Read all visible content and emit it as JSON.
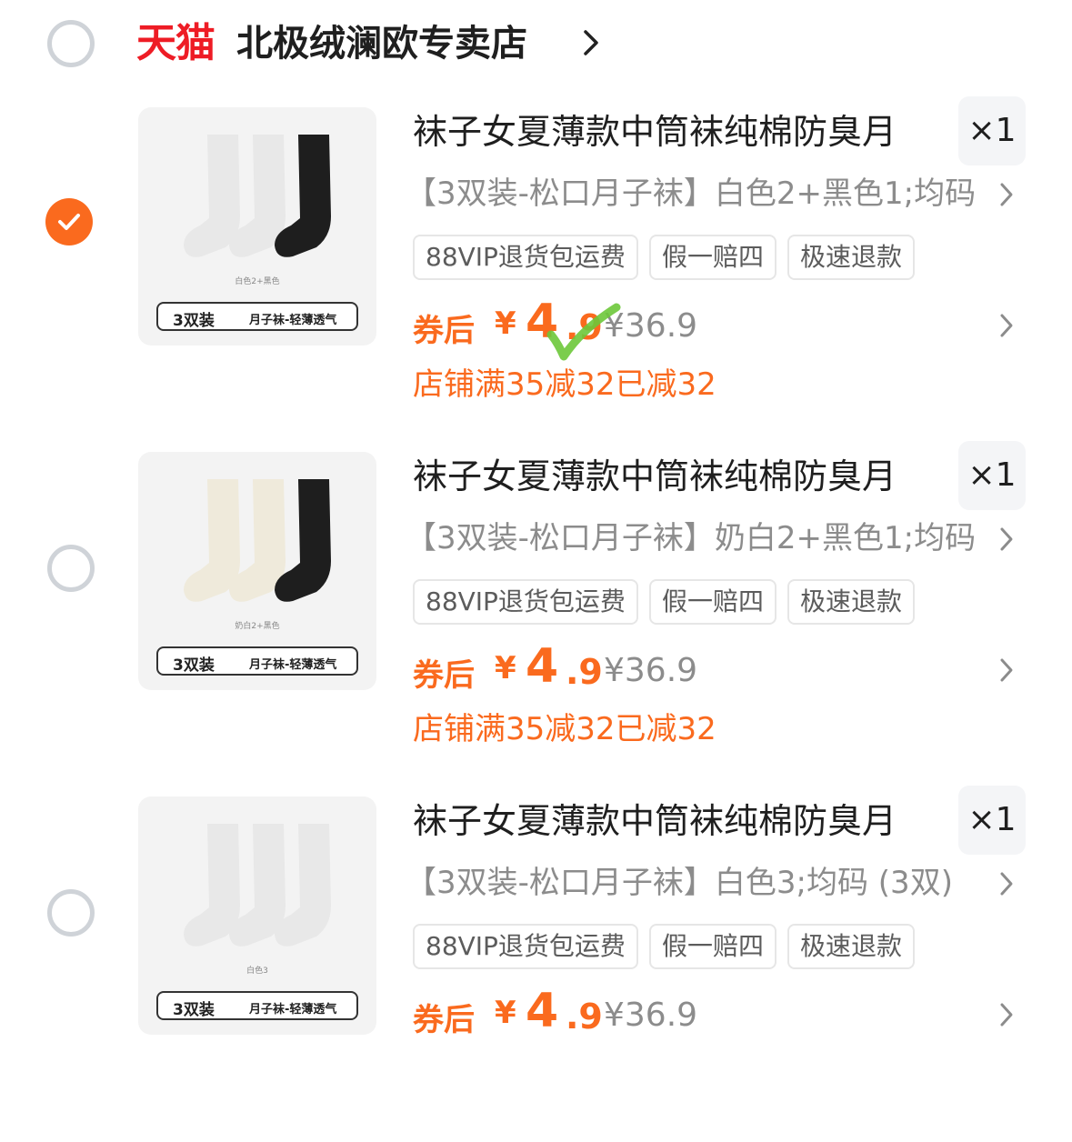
{
  "store": {
    "platform": "天猫",
    "name": "北极绒澜欧专卖店",
    "selected": false
  },
  "colors": {
    "accent": "#fa6a1e",
    "tmall_red": "#ee1c25",
    "muted": "#8c8c8c",
    "tag_border": "#e6e6e6"
  },
  "items": [
    {
      "selected": true,
      "title": "袜子女夏薄款中筒袜纯棉防臭月",
      "quantity": "×1",
      "variant": "【3双装-松口月子袜】白色2+黑色1;均码",
      "tags": [
        "88VIP退货包运费",
        "假一赔四",
        "极速退款"
      ],
      "coupon_label": "券后",
      "currency": "¥",
      "price_int": "4",
      "price_dec": ".9",
      "original_price": "¥36.9",
      "promo": "店铺满35减32已减32",
      "thumbnail": {
        "caption": "白色2+黑色",
        "pack_count": "3双装",
        "pack_feature": "月子袜-轻薄透气",
        "sock_colors": [
          "#e8e8e8",
          "#e8e8e8",
          "#1e1e1e"
        ]
      },
      "annotation": "green-check-mark-icon"
    },
    {
      "selected": false,
      "title": "袜子女夏薄款中筒袜纯棉防臭月",
      "quantity": "×1",
      "variant": "【3双装-松口月子袜】奶白2+黑色1;均码",
      "tags": [
        "88VIP退货包运费",
        "假一赔四",
        "极速退款"
      ],
      "coupon_label": "券后",
      "currency": "¥",
      "price_int": "4",
      "price_dec": ".9",
      "original_price": "¥36.9",
      "promo": "店铺满35减32已减32",
      "thumbnail": {
        "caption": "奶白2+黑色",
        "pack_count": "3双装",
        "pack_feature": "月子袜-轻薄透气",
        "sock_colors": [
          "#efeadb",
          "#efeadb",
          "#1e1e1e"
        ]
      }
    },
    {
      "selected": false,
      "title": "袜子女夏薄款中筒袜纯棉防臭月",
      "quantity": "×1",
      "variant": "【3双装-松口月子袜】白色3;均码 (3双)",
      "tags": [
        "88VIP退货包运费",
        "假一赔四",
        "极速退款"
      ],
      "coupon_label": "券后",
      "currency": "¥",
      "price_int": "4",
      "price_dec": ".9",
      "original_price": "¥36.9",
      "promo": "",
      "thumbnail": {
        "caption": "白色3",
        "pack_count": "3双装",
        "pack_feature": "月子袜-轻薄透气",
        "sock_colors": [
          "#e8e8e8",
          "#e8e8e8",
          "#e8e8e8"
        ]
      }
    }
  ]
}
